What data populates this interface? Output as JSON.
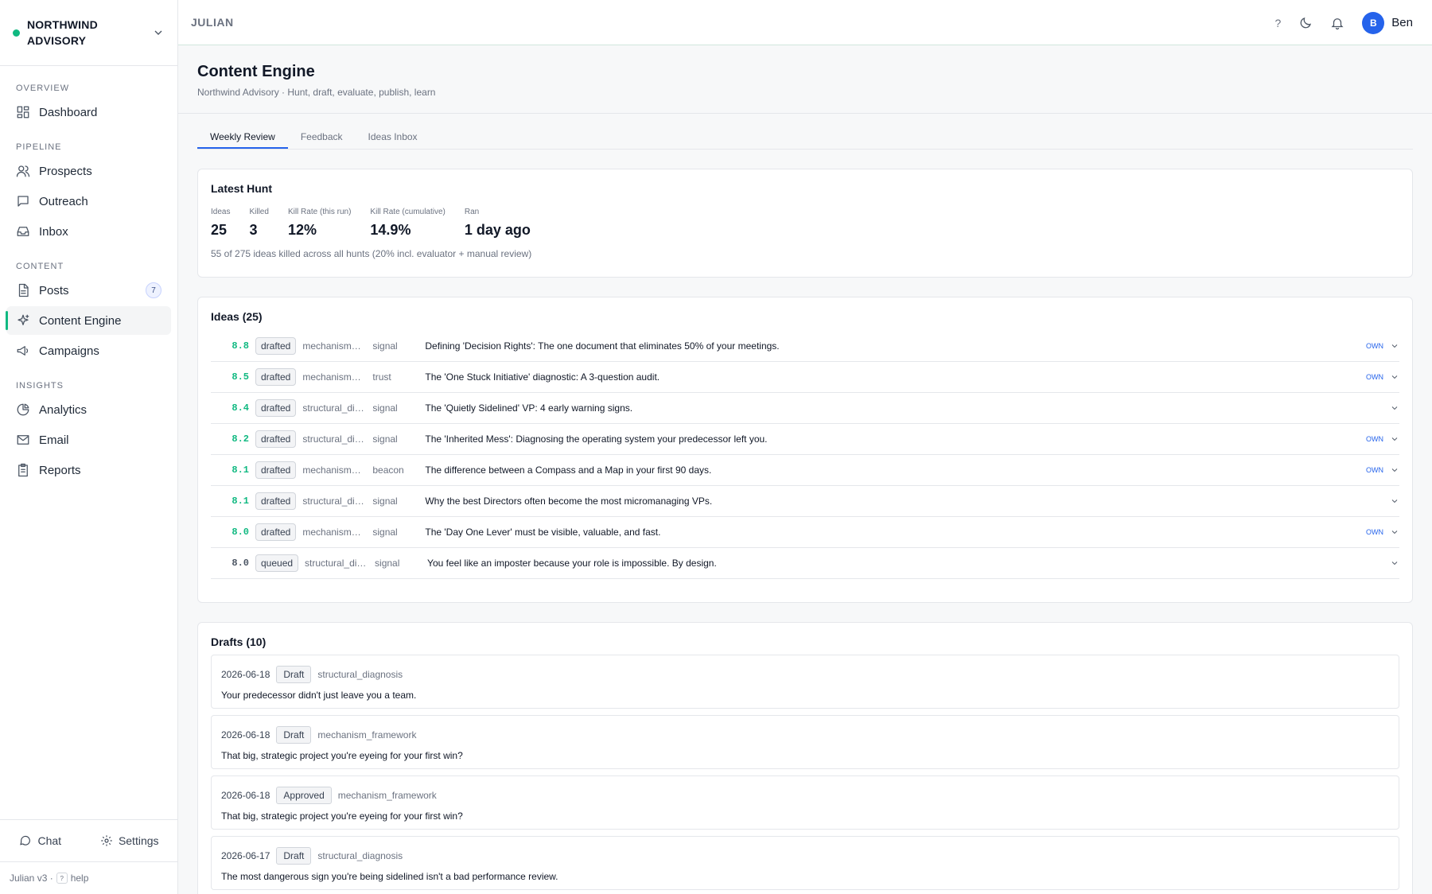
{
  "org": {
    "name": "NORTHWIND ADVISORY"
  },
  "sections": {
    "overview": "OVERVIEW",
    "pipeline": "PIPELINE",
    "content": "CONTENT",
    "insights": "INSIGHTS"
  },
  "nav": {
    "dashboard": "Dashboard",
    "prospects": "Prospects",
    "outreach": "Outreach",
    "inbox": "Inbox",
    "posts": "Posts",
    "posts_count": "7",
    "content_engine": "Content Engine",
    "campaigns": "Campaigns",
    "analytics": "Analytics",
    "email": "Email",
    "reports": "Reports"
  },
  "bottom": {
    "chat": "Chat",
    "settings": "Settings",
    "version": "Julian v3 ·",
    "help_key": "?",
    "help": "help"
  },
  "topbar": {
    "brand": "JULIAN",
    "help": "?",
    "user": "Ben",
    "avatar": "B"
  },
  "page": {
    "title": "Content Engine",
    "subtitle": "Northwind Advisory · Hunt, draft, evaluate, publish, learn"
  },
  "tabs": [
    "Weekly Review",
    "Feedback",
    "Ideas Inbox"
  ],
  "hunt": {
    "title": "Latest Hunt",
    "stats": [
      {
        "label": "Ideas",
        "value": "25"
      },
      {
        "label": "Killed",
        "value": "3"
      },
      {
        "label": "Kill Rate (this run)",
        "value": "12%"
      },
      {
        "label": "Kill Rate (cumulative)",
        "value": "14.9%"
      },
      {
        "label": "Ran",
        "value": "1 day ago"
      }
    ],
    "note": "55 of 275 ideas killed across all hunts (20% incl. evaluator + manual review)"
  },
  "ideas": {
    "title": "Ideas (25)",
    "rows": [
      {
        "score": "8.8",
        "status": "drafted",
        "pattern": "mechanism…",
        "type": "signal",
        "text": "Defining 'Decision Rights': The one document that eliminates 50% of your meetings.",
        "own": "OWN"
      },
      {
        "score": "8.5",
        "status": "drafted",
        "pattern": "mechanism…",
        "type": "trust",
        "text": "The 'One Stuck Initiative' diagnostic: A 3-question audit.",
        "own": "OWN"
      },
      {
        "score": "8.4",
        "status": "drafted",
        "pattern": "structural_di…",
        "type": "signal",
        "text": "The 'Quietly Sidelined' VP: 4 early warning signs.",
        "own": ""
      },
      {
        "score": "8.2",
        "status": "drafted",
        "pattern": "structural_di…",
        "type": "signal",
        "text": "The 'Inherited Mess': Diagnosing the operating system your predecessor left you.",
        "own": "OWN"
      },
      {
        "score": "8.1",
        "status": "drafted",
        "pattern": "mechanism…",
        "type": "beacon",
        "text": "The difference between a Compass and a Map in your first 90 days.",
        "own": "OWN"
      },
      {
        "score": "8.1",
        "status": "drafted",
        "pattern": "structural_di…",
        "type": "signal",
        "text": "Why the best Directors often become the most micromanaging VPs.",
        "own": ""
      },
      {
        "score": "8.0",
        "status": "drafted",
        "pattern": "mechanism…",
        "type": "signal",
        "text": "The 'Day One Lever' must be visible, valuable, and fast.",
        "own": "OWN"
      },
      {
        "score": "8.0",
        "status": "queued",
        "pattern": "structural_di…",
        "type": "signal",
        "text": "You feel like an imposter because your role is impossible. By design.",
        "own": ""
      }
    ]
  },
  "drafts": {
    "title": "Drafts (10)",
    "rows": [
      {
        "date": "2026-06-18",
        "badge": "Draft",
        "kind": "structural_diagnosis",
        "text": "Your predecessor didn't just leave you a team."
      },
      {
        "date": "2026-06-18",
        "badge": "Draft",
        "kind": "mechanism_framework",
        "text": "That big, strategic project you're eyeing for your first win?"
      },
      {
        "date": "2026-06-18",
        "badge": "Approved",
        "kind": "mechanism_framework",
        "text": "That big, strategic project you're eyeing for your first win?"
      },
      {
        "date": "2026-06-17",
        "badge": "Draft",
        "kind": "structural_diagnosis",
        "text": "The most dangerous sign you're being sidelined isn't a bad performance review."
      }
    ]
  }
}
